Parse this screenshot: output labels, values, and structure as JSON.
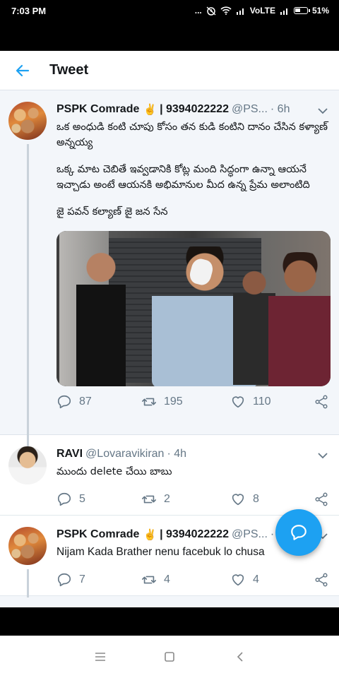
{
  "status_bar": {
    "time": "7:03 PM",
    "indicators": "...",
    "network": "VoLTE",
    "battery": "51%",
    "battery_level": 0.51
  },
  "header": {
    "title": "Tweet",
    "back_icon": "arrow-left-icon"
  },
  "tweets": [
    {
      "name": "PSPK Comrade",
      "emoji": "✌",
      "name_suffix": "| 9394022222",
      "handle": "@PS...",
      "time": "· 6h",
      "text": [
        "ఒక అంధుడి కంటి చూపు కోసం తన కుడి కంటిని దానం చేసిన కళ్యాణ్ అన్నయ్య",
        "ఒక్క మాట చెబితే ఇవ్వడానికి కోట్ల మంది సిద్ధంగా ఉన్నా ఆయనే ఇచ్చాడు అంటే ఆయనకి అభిమానుల మీద ఉన్న ప్రేమ అలాంటిది",
        "జై పవన్ కల్యాణ్ జై జన సేన"
      ],
      "replies": "87",
      "retweets": "195",
      "likes": "110"
    },
    {
      "name": "RAVI",
      "handle": "@Lovaravikiran",
      "time": "· 4h",
      "text": "ముందు delete చేయి బాబు",
      "replies": "5",
      "retweets": "2",
      "likes": "8"
    },
    {
      "name": "PSPK Comrade",
      "emoji": "✌",
      "name_suffix": "| 9394022222",
      "handle": "@PS...",
      "time": "· 4h",
      "text": "Nijam Kada Brather nenu facebuk lo chusa",
      "replies": "7",
      "retweets": "4",
      "likes": "4"
    }
  ],
  "colors": {
    "accent": "#1da1f2",
    "text": "#14171a",
    "muted": "#657786",
    "background": "#f3f6fa"
  },
  "icons": {
    "reply": "reply-bubble-icon",
    "retweet": "retweet-icon",
    "like": "heart-icon",
    "share": "share-icon",
    "more": "chevron-down-icon",
    "compose": "compose-reply-icon"
  },
  "system_nav": {
    "menu": "menu-icon",
    "home": "home-icon",
    "back": "back-icon"
  }
}
